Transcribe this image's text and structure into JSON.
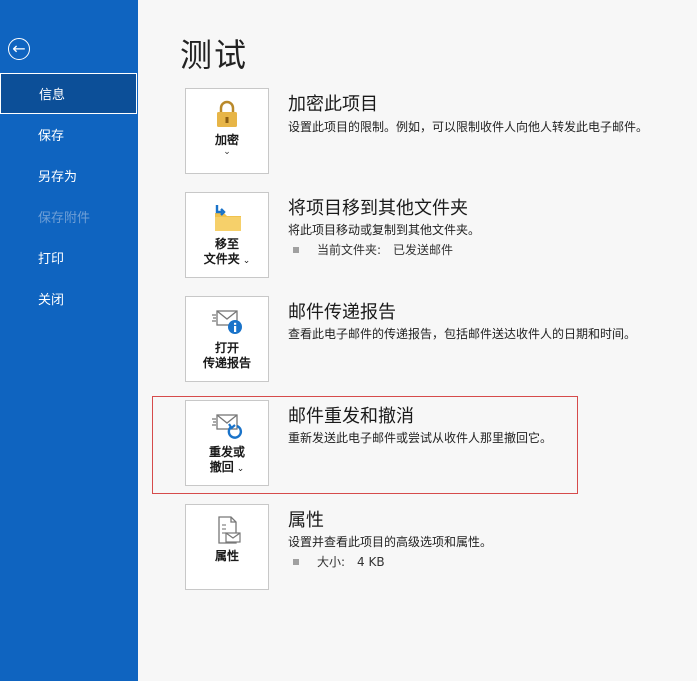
{
  "sidebar": {
    "back_glyph": "←",
    "items": [
      {
        "label": "信息",
        "active": true,
        "disabled": false
      },
      {
        "label": "保存",
        "active": false,
        "disabled": false
      },
      {
        "label": "另存为",
        "active": false,
        "disabled": false
      },
      {
        "label": "保存附件",
        "active": false,
        "disabled": true
      },
      {
        "label": "打印",
        "active": false,
        "disabled": false
      },
      {
        "label": "关闭",
        "active": false,
        "disabled": false
      }
    ]
  },
  "main": {
    "title": "测试",
    "sections": [
      {
        "button_label": "加密",
        "has_dropdown": true,
        "icon": "lock-icon",
        "title": "加密此项目",
        "description": "设置此项目的限制。例如，可以限制收件人向他人转发此电子邮件。"
      },
      {
        "button_label": "移至\n文件夹",
        "has_dropdown": true,
        "icon": "move-folder-icon",
        "title": "将项目移到其他文件夹",
        "description": "将此项目移动或复制到其他文件夹。",
        "detail_label": "当前文件夹:",
        "detail_value": "已发送邮件"
      },
      {
        "button_label": "打开\n传递报告",
        "has_dropdown": false,
        "icon": "delivery-report-icon",
        "title": "邮件传递报告",
        "description": "查看此电子邮件的传递报告，包括邮件送达收件人的日期和时间。"
      },
      {
        "button_label": "重发或\n撤回",
        "has_dropdown": true,
        "icon": "resend-recall-icon",
        "title": "邮件重发和撤消",
        "description": "重新发送此电子邮件或尝试从收件人那里撤回它。"
      },
      {
        "button_label": "属性",
        "has_dropdown": false,
        "icon": "properties-icon",
        "title": "属性",
        "description": "设置并查看此项目的高级选项和属性。",
        "detail_label": "大小:",
        "detail_value": "4 KB"
      }
    ]
  },
  "colors": {
    "sidebar_bg": "#0f64c0",
    "sidebar_active_bg": "#0c4f98",
    "highlight_border": "#d64b4b",
    "main_bg": "#f7f7f7"
  }
}
